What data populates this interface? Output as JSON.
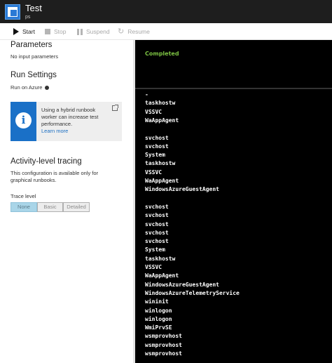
{
  "window": {
    "title": "Test",
    "subtitle": "ps"
  },
  "toolbar": {
    "start": "Start",
    "stop": "Stop",
    "suspend": "Suspend",
    "resume": "Resume"
  },
  "left": {
    "parameters_heading": "Parameters",
    "parameters_text": "No input parameters",
    "run_settings_heading": "Run Settings",
    "run_on": "Run on Azure",
    "info": {
      "line1": "Using a hybrid runbook",
      "line2": "worker can increase test",
      "line3": "performance.",
      "link": "Learn more"
    },
    "tracing_heading": "Activity-level tracing",
    "tracing_line1": "This configuration is available only for",
    "tracing_line2": "graphical runbooks.",
    "trace_label": "Trace level",
    "trace_options": [
      "None",
      "Basic",
      "Detailed"
    ],
    "trace_selected": "None"
  },
  "output": {
    "status": "Completed",
    "lines": [
      "-",
      "taskhostw",
      "VSSVC",
      "WaAppAgent",
      "",
      "svchost",
      "svchost",
      "System",
      "taskhostw",
      "VSSVC",
      "WaAppAgent",
      "WindowsAzureGuestAgent",
      "",
      "svchost",
      "svchost",
      "svchost",
      "svchost",
      "svchost",
      "System",
      "taskhostw",
      "VSSVC",
      "WaAppAgent",
      "WindowsAzureGuestAgent",
      "WindowsAzureTelemetryService",
      "wininit",
      "winlogon",
      "winlogon",
      "WmiPrvSE",
      "wsmprovhost",
      "wsmprovhost",
      "wsmprovhost"
    ]
  },
  "colors": {
    "accent": "#1a70c7",
    "status_green": "#7cc242",
    "selected_segment": "#a9d5e8"
  },
  "icons": {
    "app": "runbook-window-icon",
    "start": "play-icon",
    "stop": "stop-icon",
    "suspend": "pause-icon",
    "resume": "resume-icon",
    "info": "info-icon",
    "external": "external-link-icon"
  }
}
